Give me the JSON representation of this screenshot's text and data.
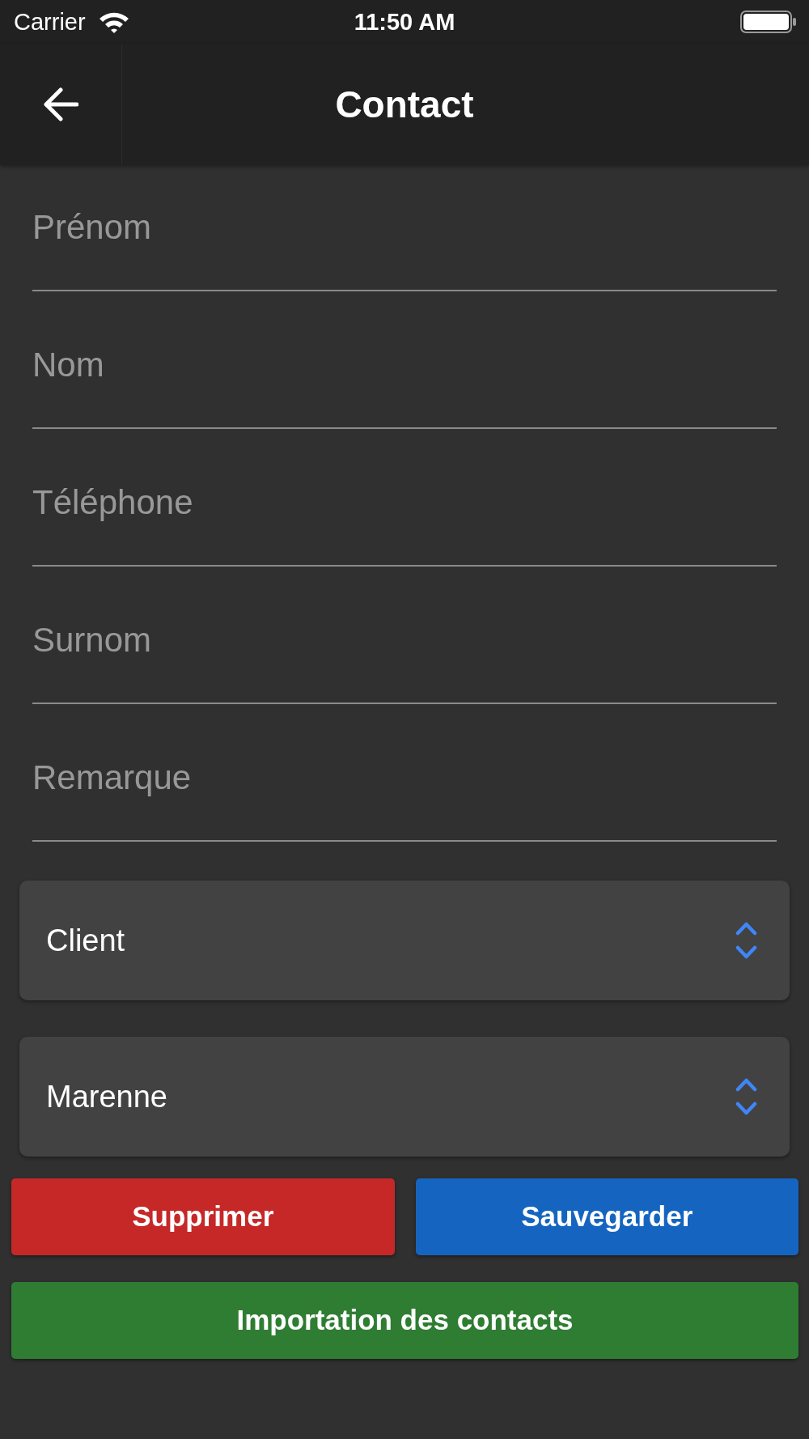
{
  "status_bar": {
    "carrier": "Carrier",
    "time": "11:50 AM"
  },
  "nav_bar": {
    "title": "Contact"
  },
  "fields": [
    {
      "placeholder": "Prénom"
    },
    {
      "placeholder": "Nom"
    },
    {
      "placeholder": "Téléphone"
    },
    {
      "placeholder": "Surnom"
    },
    {
      "placeholder": "Remarque"
    }
  ],
  "selects": [
    {
      "value": "Client"
    },
    {
      "value": "Marenne"
    }
  ],
  "button_rows": [
    [
      {
        "label": "Supprimer",
        "kind": "danger"
      },
      {
        "label": "Sauvegarder",
        "kind": "primary"
      }
    ],
    [
      {
        "label": "Importation des contacts",
        "kind": "success"
      }
    ]
  ]
}
